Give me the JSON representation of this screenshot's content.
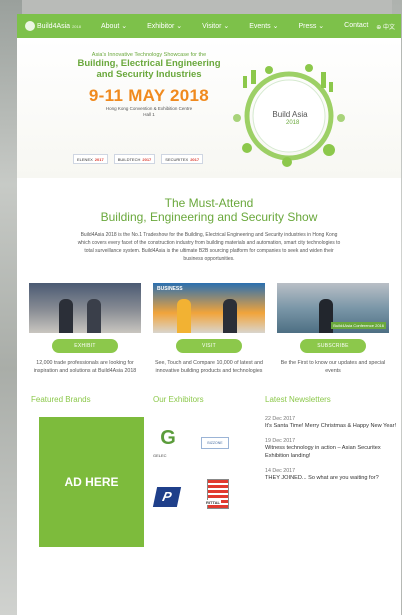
{
  "nav": {
    "logo_text": "Build4Asia",
    "logo_sub": "2018",
    "items": [
      "About ⌄",
      "Exhibitor ⌄",
      "Visitor ⌄",
      "Events ⌄",
      "Press ⌄",
      "Contact"
    ],
    "lang": "⊕ 中文"
  },
  "hero": {
    "subtitle": "Asia's Innovative Technology Showcase for the",
    "title_line1": "Building, Electrical Engineering",
    "title_line2": "and Security Industries",
    "dates": "9-11 MAY 2018",
    "venue_line1": "Hong Kong Convention & Exhibition Centre",
    "venue_line2": "Hall 1",
    "partners": [
      {
        "name": "ELENEX",
        "year": "2017"
      },
      {
        "name": "BUILDTECH",
        "year": "2017"
      },
      {
        "name": "SECURITEX",
        "year": "2017"
      }
    ],
    "globe_label": "Build Asia",
    "globe_year": "2018"
  },
  "intro": {
    "title1": "The Must-Attend",
    "title2": "Building, Engineering and Security Show",
    "body": "Build4Asia 2018 is the No.1 Tradeshow for the Building, Electrical Engineering and Security industries in Hong Kong which covers every facet of the construction industry from building materials and automation, smart city technologies to total surveillance system. Build4Asia is the ultimate B2B sourcing platform for companies to seek and widen their business opportunities."
  },
  "cards": [
    {
      "button": "EXHIBIT",
      "text": "12,000 trade professionals are looking for inspiration and solutions at Build4Asia 2018",
      "tag": "",
      "badge": ""
    },
    {
      "button": "VISIT",
      "text": "See, Touch and Compare 10,000 of latest and innovative building products and technologies",
      "tag": "BUSINESS",
      "badge": ""
    },
    {
      "button": "SUBSCRIBE",
      "text": "Be the First to know our updates and special events",
      "tag": "",
      "badge": "Build4Asia Conference 2016"
    }
  ],
  "featured": {
    "title": "Featured Brands",
    "ad": "AD HERE"
  },
  "exhibitors": {
    "title": "Our Exhibitors",
    "logos": {
      "gelec": "GELEC",
      "bz": "BIZZONE",
      "rittal": "RITTAL",
      "p": "P"
    }
  },
  "newsletters": {
    "title": "Latest Newsletters",
    "items": [
      {
        "date": "22 Dec 2017",
        "text": "It's Santa Time! Merry Christmas & Happy New Year!"
      },
      {
        "date": "19 Dec 2017",
        "text": "Witness technology in action – Asian Securitex Exhibition landing!"
      },
      {
        "date": "14 Dec 2017",
        "text": "THEY JOINED... So what are you waiting for?"
      }
    ]
  },
  "colors": {
    "brand_green": "#7dc14a",
    "accent_orange": "#f08a1e",
    "ad_green": "#7dbb3c"
  }
}
